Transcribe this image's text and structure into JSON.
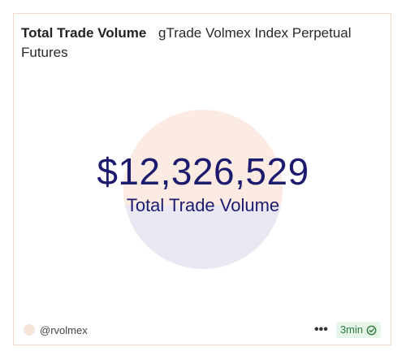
{
  "header": {
    "title": "Total Trade Volume",
    "subtitle": "gTrade Volmex Index Perpetual Futures"
  },
  "metric": {
    "value": "$12,326,529",
    "label": "Total Trade Volume"
  },
  "footer": {
    "user": "@rvolmex",
    "more_icon": "more-horizontal-icon",
    "time_badge": "3min",
    "status_icon": "check-circle-icon"
  },
  "colors": {
    "accent": "#1d1b6e",
    "circle_top": "#fcebe3",
    "circle_bottom": "#e9e8f2",
    "border": "#f1d7cc",
    "badge_bg": "#e7f6ea",
    "badge_text": "#2a7a3b"
  }
}
